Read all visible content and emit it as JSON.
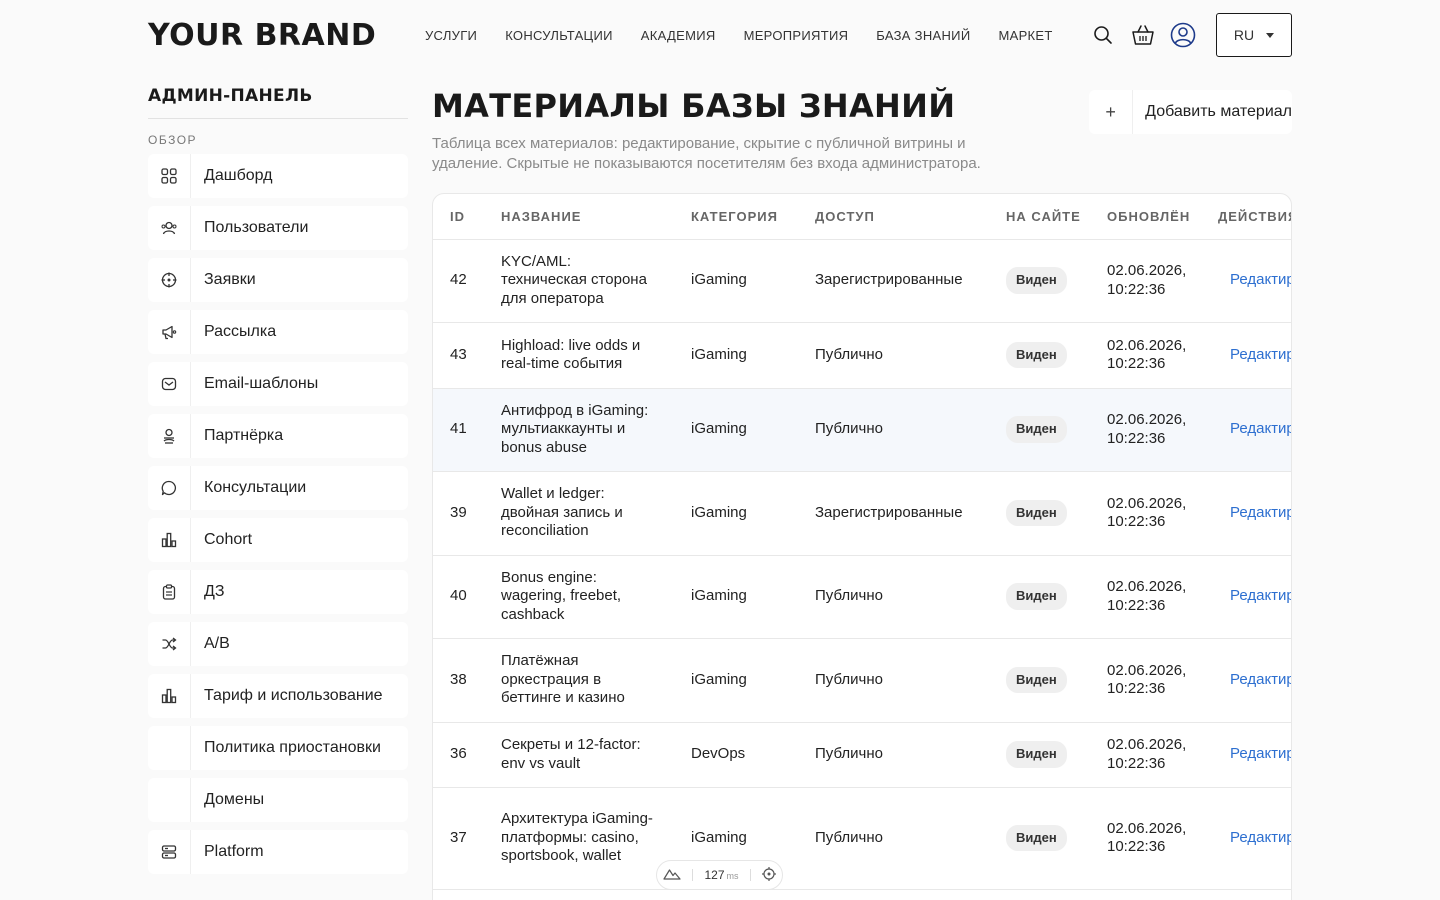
{
  "header": {
    "brand": "YOUR BRAND",
    "nav": [
      "УСЛУГИ",
      "КОНСУЛЬТАЦИИ",
      "АКАДЕМИЯ",
      "МЕРОПРИЯТИЯ",
      "БАЗА ЗНАНИЙ",
      "МАРКЕТ"
    ],
    "language": "RU"
  },
  "sidebar": {
    "title": "АДМИН-ПАНЕЛЬ",
    "section": "ОБЗОР",
    "items": [
      {
        "label": "Дашборд",
        "icon": "grid-icon"
      },
      {
        "label": "Пользователи",
        "icon": "users-icon"
      },
      {
        "label": "Заявки",
        "icon": "target-icon"
      },
      {
        "label": "Рассылка",
        "icon": "megaphone-icon"
      },
      {
        "label": "Email-шаблоны",
        "icon": "mail-icon"
      },
      {
        "label": "Партнёрка",
        "icon": "partner-icon"
      },
      {
        "label": "Консультации",
        "icon": "chat-icon"
      },
      {
        "label": "Cohort",
        "icon": "bar-chart-icon"
      },
      {
        "label": "ДЗ",
        "icon": "clipboard-icon"
      },
      {
        "label": "A/B",
        "icon": "shuffle-icon"
      },
      {
        "label": "Тариф и использование",
        "icon": "bar-chart-icon"
      },
      {
        "label": "Политика приостановки",
        "icon": ""
      },
      {
        "label": "Домены",
        "icon": ""
      },
      {
        "label": "Platform",
        "icon": "server-icon"
      }
    ]
  },
  "main": {
    "title": "МАТЕРИАЛЫ БАЗЫ ЗНАНИЙ",
    "description": "Таблица всех материалов: редактирование, скрытие с публичной витрины и удаление. Скрытые не показываются посетителям без входа администратора.",
    "add_button": "Добавить материал",
    "add_icon": "plus-icon"
  },
  "table": {
    "columns": [
      "ID",
      "НАЗВАНИЕ",
      "КАТЕГОРИЯ",
      "ДОСТУП",
      "НА САЙТЕ",
      "ОБНОВЛЁН",
      "ДЕЙСТВИЯ"
    ],
    "rows": [
      {
        "id": "42",
        "name": "KYC/AML: техническая сторона для оператора",
        "category": "iGaming",
        "access": "Зарегистрированные",
        "status": "Виден",
        "updated": "02.06.2026, 10:22:36",
        "action": "Редактировать"
      },
      {
        "id": "43",
        "name": "Highload: live odds и real-time события",
        "category": "iGaming",
        "access": "Публично",
        "status": "Виден",
        "updated": "02.06.2026, 10:22:36",
        "action": "Редактировать"
      },
      {
        "id": "41",
        "name": "Антифрод в iGaming: мультиаккаунты и bonus abuse",
        "category": "iGaming",
        "access": "Публично",
        "status": "Виден",
        "updated": "02.06.2026, 10:22:36",
        "action": "Редактировать"
      },
      {
        "id": "39",
        "name": "Wallet и ledger: двойная запись и reconciliation",
        "category": "iGaming",
        "access": "Зарегистрированные",
        "status": "Виден",
        "updated": "02.06.2026, 10:22:36",
        "action": "Редактировать"
      },
      {
        "id": "40",
        "name": "Bonus engine: wagering, freebet, cashback",
        "category": "iGaming",
        "access": "Публично",
        "status": "Виден",
        "updated": "02.06.2026, 10:22:36",
        "action": "Редактировать"
      },
      {
        "id": "38",
        "name": "Платёжная оркестрация в беттинге и казино",
        "category": "iGaming",
        "access": "Публично",
        "status": "Виден",
        "updated": "02.06.2026, 10:22:36",
        "action": "Редактировать"
      },
      {
        "id": "36",
        "name": "Секреты и 12-factor: env vs vault",
        "category": "DevOps",
        "access": "Публично",
        "status": "Виден",
        "updated": "02.06.2026, 10:22:36",
        "action": "Редактировать"
      },
      {
        "id": "37",
        "name": "Архитектура iGaming-платформы: casino, sportsbook, wallet",
        "category": "iGaming",
        "access": "Публично",
        "status": "Виден",
        "updated": "02.06.2026, 10:22:36",
        "action": "Редактировать"
      }
    ]
  },
  "devbar": {
    "value": "127",
    "unit": "ms"
  }
}
